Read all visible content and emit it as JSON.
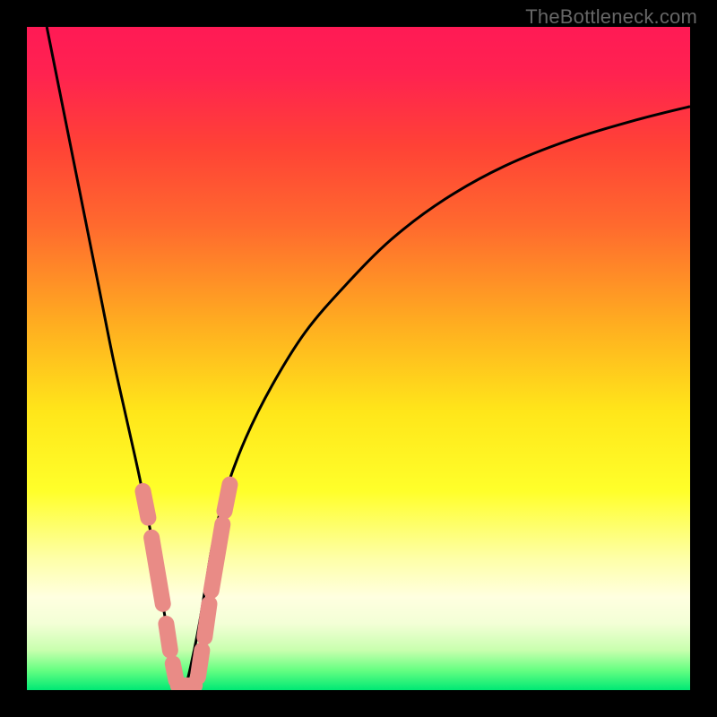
{
  "watermark": "TheBottleneck.com",
  "colors": {
    "bg": "#000000",
    "gradient_stops": [
      {
        "offset": 0.0,
        "color": "#ff1a55"
      },
      {
        "offset": 0.07,
        "color": "#ff2250"
      },
      {
        "offset": 0.18,
        "color": "#ff4236"
      },
      {
        "offset": 0.3,
        "color": "#ff6a2e"
      },
      {
        "offset": 0.45,
        "color": "#ffae20"
      },
      {
        "offset": 0.58,
        "color": "#ffe61a"
      },
      {
        "offset": 0.7,
        "color": "#ffff2a"
      },
      {
        "offset": 0.8,
        "color": "#feffa6"
      },
      {
        "offset": 0.86,
        "color": "#ffffe0"
      },
      {
        "offset": 0.9,
        "color": "#f3ffd6"
      },
      {
        "offset": 0.94,
        "color": "#c8ffae"
      },
      {
        "offset": 0.97,
        "color": "#66ff82"
      },
      {
        "offset": 1.0,
        "color": "#00e874"
      }
    ],
    "curve": "#000000",
    "marker_fill": "#e98b86",
    "marker_stroke": "#e98b86"
  },
  "chart_data": {
    "type": "line",
    "title": "",
    "xlabel": "",
    "ylabel": "",
    "xlim": [
      0,
      100
    ],
    "ylim": [
      0,
      100
    ],
    "note": "V-shaped bottleneck curve; y≈0 at balance point x≈23, rising sharply on both sides. Values estimated from pixel geometry.",
    "series": [
      {
        "name": "bottleneck-curve",
        "x": [
          3,
          5,
          7,
          9,
          11,
          13,
          15,
          17,
          19,
          20,
          21,
          22,
          23,
          24,
          25,
          26,
          27,
          28,
          30,
          33,
          37,
          42,
          48,
          55,
          63,
          72,
          82,
          92,
          100
        ],
        "y": [
          100,
          90,
          80,
          70,
          60,
          50,
          41,
          32,
          22,
          16,
          10,
          5,
          1,
          1,
          5,
          10,
          16,
          22,
          30,
          38,
          46,
          54,
          61,
          68,
          74,
          79,
          83,
          86,
          88
        ]
      }
    ],
    "markers": [
      {
        "segment": "left",
        "x_start": 17.5,
        "y_start": 30,
        "x_end": 18.3,
        "y_end": 26,
        "shape": "capsule"
      },
      {
        "segment": "left",
        "x_start": 18.8,
        "y_start": 23,
        "x_end": 20.5,
        "y_end": 13,
        "shape": "capsule-long"
      },
      {
        "segment": "left",
        "x_start": 21.0,
        "y_start": 10,
        "x_end": 21.6,
        "y_end": 6,
        "shape": "capsule"
      },
      {
        "segment": "left",
        "x_start": 22.0,
        "y_start": 4,
        "x_end": 22.5,
        "y_end": 1.5,
        "shape": "capsule"
      },
      {
        "segment": "bottom",
        "x_start": 22.8,
        "y_start": 0.7,
        "x_end": 25.3,
        "y_end": 0.7,
        "shape": "capsule-horiz"
      },
      {
        "segment": "right",
        "x_start": 25.8,
        "y_start": 2,
        "x_end": 26.4,
        "y_end": 6,
        "shape": "capsule"
      },
      {
        "segment": "right",
        "x_start": 26.8,
        "y_start": 8,
        "x_end": 27.5,
        "y_end": 13,
        "shape": "capsule"
      },
      {
        "segment": "right",
        "x_start": 27.8,
        "y_start": 15,
        "x_end": 29.5,
        "y_end": 25,
        "shape": "capsule-long"
      },
      {
        "segment": "right",
        "x_start": 29.8,
        "y_start": 27,
        "x_end": 30.6,
        "y_end": 31,
        "shape": "capsule"
      }
    ]
  }
}
